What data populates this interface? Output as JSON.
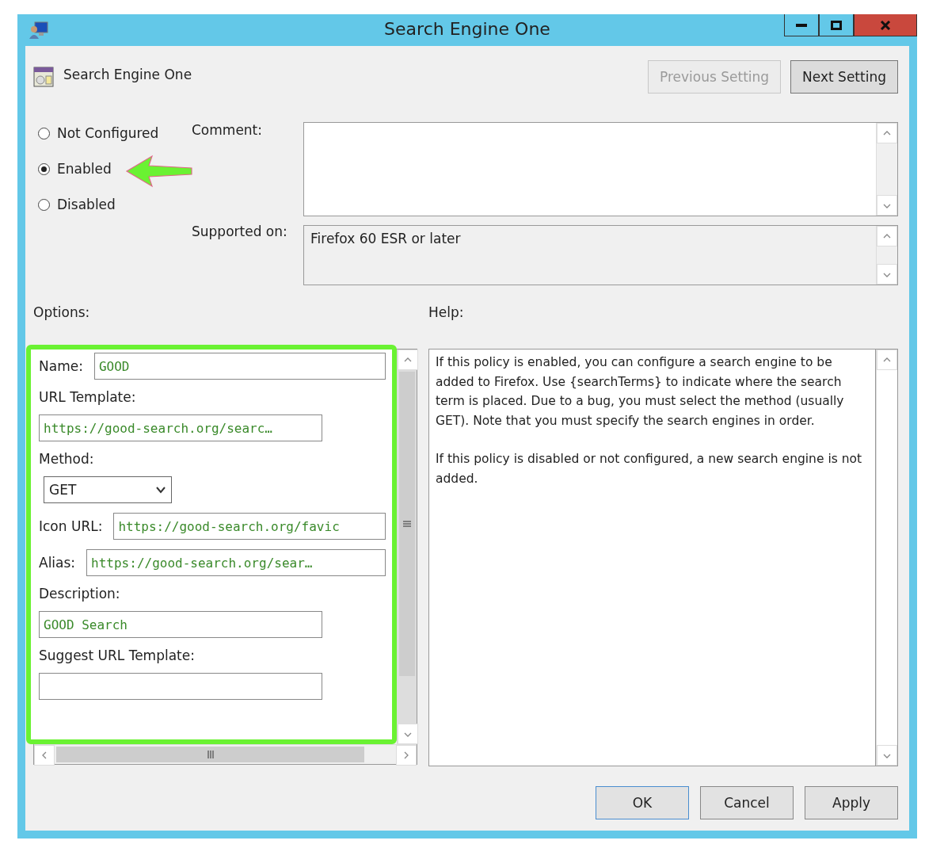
{
  "window": {
    "title": "Search Engine One"
  },
  "header": {
    "title": "Search Engine One"
  },
  "nav_buttons": [
    {
      "label": "Previous Setting",
      "disabled": true
    },
    {
      "label": "Next Setting",
      "disabled": false
    }
  ],
  "states": [
    {
      "label": "Not Configured",
      "selected": false
    },
    {
      "label": "Enabled",
      "selected": true
    },
    {
      "label": "Disabled",
      "selected": false
    }
  ],
  "comment": {
    "label": "Comment:"
  },
  "supported_on": {
    "label": "Supported on:",
    "value": "Firefox 60 ESR or later"
  },
  "options": {
    "label": "Options:",
    "fields": [
      {
        "kind": "inline",
        "label": "Name:",
        "value": "GOOD"
      },
      {
        "kind": "stacked",
        "label": "URL Template:",
        "value": "https://good-search.org/searc…"
      },
      {
        "kind": "select",
        "label": "Method:",
        "value": "GET"
      },
      {
        "kind": "inline",
        "label": "Icon URL:",
        "value": "https://good-search.org/favic"
      },
      {
        "kind": "inline",
        "label": "Alias:",
        "value": "https://good-search.org/sear…"
      },
      {
        "kind": "stacked",
        "label": "Description:",
        "value": "GOOD Search"
      },
      {
        "kind": "stacked",
        "label": "Suggest URL Template:"
      }
    ]
  },
  "help": {
    "label": "Help:",
    "paragraphs": [
      "If this policy is enabled, you can configure a search engine to be added to Firefox. Use {searchTerms} to indicate where the search term is placed. Due to a bug, you must select the method (usually GET). Note that you must specify the search engines in order.",
      "If this policy is disabled or not configured, a new search engine is not added."
    ]
  },
  "buttons": [
    {
      "label": "OK",
      "default": true
    },
    {
      "label": "Cancel",
      "default": false
    },
    {
      "label": "Apply",
      "default": false
    }
  ]
}
